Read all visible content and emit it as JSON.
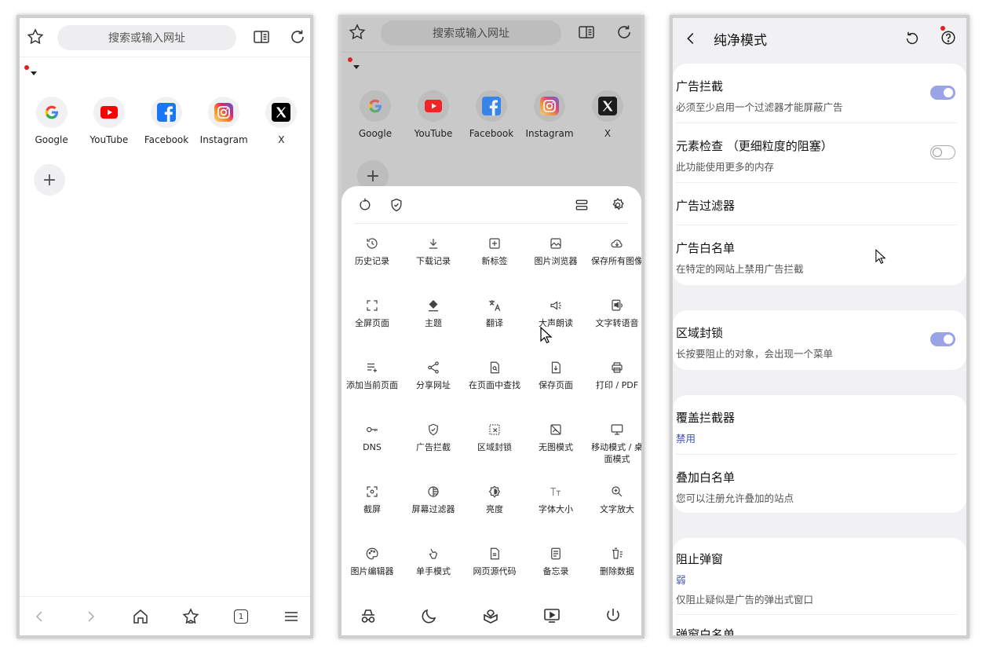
{
  "colors": {
    "accent": "#9aa3e6",
    "link_blue": "#3f51b5",
    "red_dot": "#e02020"
  },
  "browser": {
    "address_placeholder": "搜索或输入网址",
    "shortcuts": [
      {
        "label": "Google",
        "icon": "google-icon"
      },
      {
        "label": "YouTube",
        "icon": "youtube-icon"
      },
      {
        "label": "Facebook",
        "icon": "facebook-icon"
      },
      {
        "label": "Instagram",
        "icon": "instagram-icon"
      },
      {
        "label": "X",
        "icon": "x-icon"
      }
    ],
    "add_shortcut": "+",
    "tab_count": "1"
  },
  "menu": {
    "items": [
      {
        "label": "历史记录",
        "icon": "history-icon"
      },
      {
        "label": "下载记录",
        "icon": "download-icon"
      },
      {
        "label": "新标签",
        "icon": "new-tab-icon"
      },
      {
        "label": "图片浏览器",
        "icon": "image-browser-icon"
      },
      {
        "label": "保存所有图像",
        "icon": "cloud-save-icon"
      },
      {
        "label": "全屏页面",
        "icon": "fullscreen-icon"
      },
      {
        "label": "主题",
        "icon": "theme-icon"
      },
      {
        "label": "翻译",
        "icon": "translate-icon"
      },
      {
        "label": "大声朗读",
        "icon": "read-aloud-icon"
      },
      {
        "label": "文字转语音",
        "icon": "tts-icon"
      },
      {
        "label": "添加当前页面",
        "icon": "add-page-icon"
      },
      {
        "label": "分享网址",
        "icon": "share-icon"
      },
      {
        "label": "在页面中查找",
        "icon": "find-icon"
      },
      {
        "label": "保存页面",
        "icon": "save-page-icon"
      },
      {
        "label": "打印 / PDF",
        "icon": "print-icon"
      },
      {
        "label": "DNS",
        "icon": "dns-key-icon"
      },
      {
        "label": "广告拦截",
        "icon": "shield-icon"
      },
      {
        "label": "区域封锁",
        "icon": "area-block-icon"
      },
      {
        "label": "无图模式",
        "icon": "no-image-icon"
      },
      {
        "label": "移动模式 / 桌面模式",
        "icon": "monitor-icon"
      },
      {
        "label": "截屏",
        "icon": "screenshot-icon"
      },
      {
        "label": "屏幕过滤器",
        "icon": "screen-filter-icon"
      },
      {
        "label": "亮度",
        "icon": "brightness-icon"
      },
      {
        "label": "字体大小",
        "icon": "font-size-icon"
      },
      {
        "label": "文字放大",
        "icon": "zoom-icon"
      },
      {
        "label": "图片编辑器",
        "icon": "palette-icon"
      },
      {
        "label": "单手模式",
        "icon": "one-hand-icon"
      },
      {
        "label": "网页源代码",
        "icon": "source-code-icon"
      },
      {
        "label": "备忘录",
        "icon": "memo-icon"
      },
      {
        "label": "删除数据",
        "icon": "delete-data-icon"
      }
    ]
  },
  "settings": {
    "title": "纯净模式",
    "ad_block": {
      "title": "广告拦截",
      "subtitle": "必须至少启用一个过滤器才能屏蔽广告",
      "enabled": true
    },
    "element_inspect": {
      "title": "元素检查 （更细粒度的阻塞）",
      "subtitle": "此功能使用更多的内存",
      "enabled": false
    },
    "ad_filters": {
      "title": "广告过滤器"
    },
    "ad_whitelist": {
      "title": "广告白名单",
      "subtitle": "在特定的网站上禁用广告拦截"
    },
    "area_block": {
      "title": "区域封锁",
      "subtitle": "长按要阻止的对象，会出现一个菜单",
      "enabled": true
    },
    "overlay_blocker": {
      "title": "覆盖拦截器",
      "value": "禁用"
    },
    "overlay_whitelist": {
      "title": "叠加白名单",
      "subtitle": "您可以注册允许叠加的站点"
    },
    "popup_block": {
      "title": "阻止弹窗",
      "value": "弱",
      "subtitle": "仅阻止疑似是广告的弹出式窗口"
    },
    "popup_whitelist": {
      "title": "弹窗白名单"
    }
  }
}
